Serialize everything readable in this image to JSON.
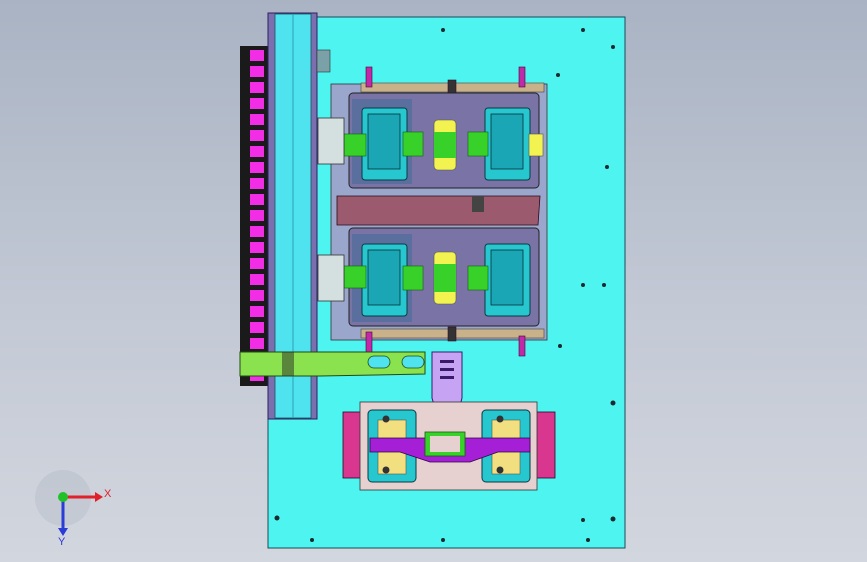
{
  "viewport": {
    "view": "cad-assembly-front-view",
    "colors": {
      "background_top": "#a9b3c3",
      "background_bottom": "#d2d6de",
      "base_plate": "#4df4f0",
      "rail": "#4ee3ef",
      "chain": "#f12ee6",
      "fixture_plate": "#9aa6cc",
      "module_frame": "#7a73a6",
      "part_cyan": "#27c7cf",
      "part_green": "#37d12a",
      "part_yellow": "#f2f250",
      "arm_green": "#8ae34e",
      "accent_purple": "#c6a4f3",
      "accent_magenta": "#d8368f",
      "divider": "#9c5a6e"
    },
    "icons": [
      "coordinate-triad-icon",
      "drag-chain-icon",
      "gripper-fixture-icon"
    ]
  },
  "triad": {
    "x_label": "X",
    "y_label": "Y",
    "x_color": "#e0202a",
    "y_color": "#2a3bd6",
    "z_color": "#22c12a"
  }
}
